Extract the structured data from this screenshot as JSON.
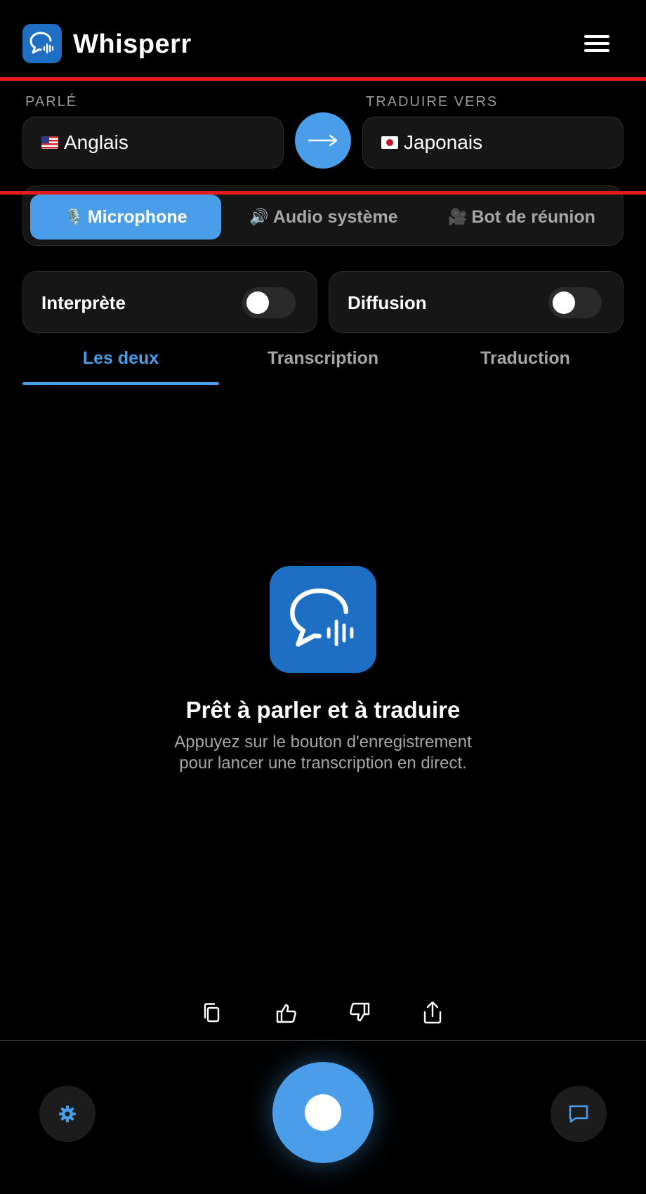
{
  "app": {
    "title": "Whisperr"
  },
  "languages": {
    "spoken_label": "PARLÉ",
    "spoken_value": "Anglais",
    "target_label": "TRADUIRE VERS",
    "target_value": "Japonais"
  },
  "source_tabs": [
    {
      "emoji": "🎙️",
      "label": "Microphone",
      "active": true
    },
    {
      "emoji": "🔊",
      "label": "Audio système",
      "active": false
    },
    {
      "emoji": "🎥",
      "label": "Bot de réunion",
      "active": false
    }
  ],
  "toggles": [
    {
      "label": "Interprète",
      "on": false
    },
    {
      "label": "Diffusion",
      "on": false
    }
  ],
  "view_tabs": [
    {
      "label": "Les deux",
      "active": true
    },
    {
      "label": "Transcription",
      "active": false
    },
    {
      "label": "Traduction",
      "active": false
    }
  ],
  "empty_state": {
    "title": "Prêt à parler et à traduire",
    "description": "Appuyez sur le bouton d'enregistrement pour lancer une transcription en direct."
  },
  "colors": {
    "accent": "#4a9de8",
    "logo": "#1e6fc4",
    "background": "#000000",
    "card": "#161616",
    "highlight_line": "#e41b1b"
  },
  "icons": [
    "copy-icon",
    "thumbs-up-icon",
    "thumbs-down-icon",
    "share-icon",
    "gear-icon",
    "chat-icon",
    "menu-icon",
    "arrow-right-icon"
  ]
}
